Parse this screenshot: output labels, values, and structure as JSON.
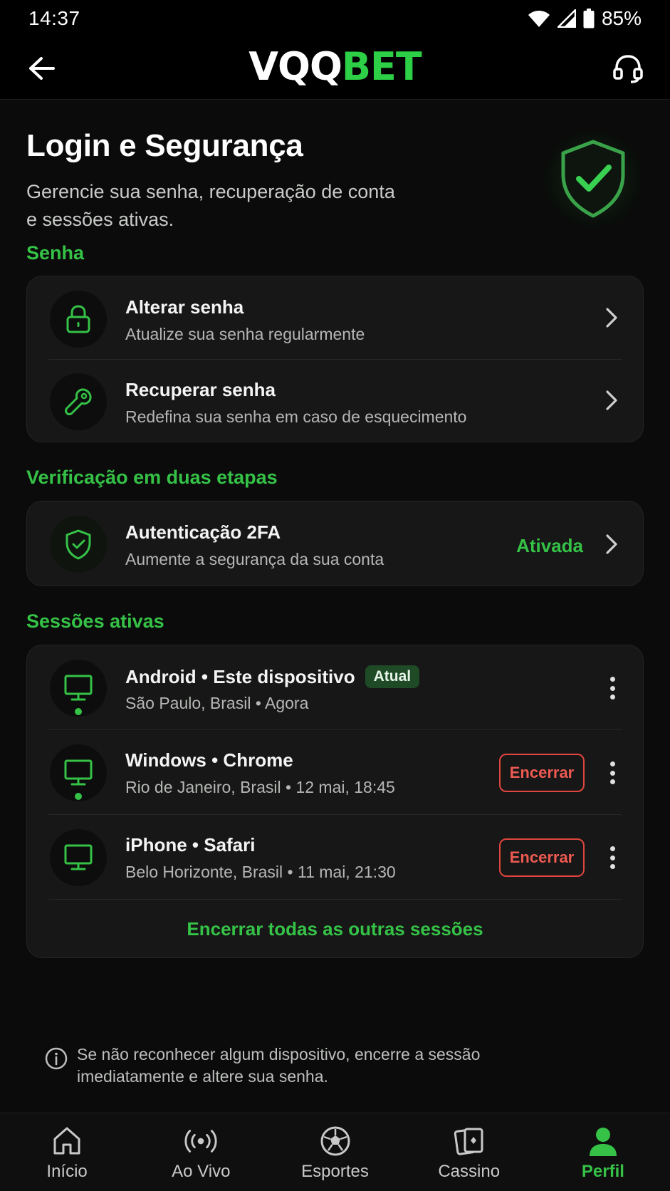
{
  "status_bar": {
    "time": "14:37",
    "battery": "85%"
  },
  "header": {
    "logo_white": "VQQ",
    "logo_green": "BET"
  },
  "hero": {
    "title": "Login e Segurança",
    "subtitle_line1": "Gerencie sua senha, recuperação de conta",
    "subtitle_line2": "e sessões ativas."
  },
  "password_section": {
    "label": "Senha",
    "items": [
      {
        "title": "Alterar senha",
        "subtitle": "Atualize sua senha regularmente",
        "icon": "lock-icon"
      },
      {
        "title": "Recuperar senha",
        "subtitle": "Redefina sua senha em caso de esquecimento",
        "icon": "key-icon"
      }
    ]
  },
  "twofa_section": {
    "label": "Verificação em duas etapas",
    "title": "Autenticação 2FA",
    "subtitle": "Aumente a segurança da sua conta",
    "status": "Ativada",
    "icon": "shield-check-icon"
  },
  "sessions_section": {
    "label": "Sessões ativas",
    "sessions": [
      {
        "title": "Android • Este dispositivo",
        "badge": "Atual",
        "subtitle": "São Paulo, Brasil • Agora",
        "online": true
      },
      {
        "title": "Windows • Chrome",
        "subtitle": "Rio de Janeiro, Brasil • 12 mai, 18:45",
        "action": "Encerrar",
        "online": true
      },
      {
        "title": "iPhone • Safari",
        "subtitle": "Belo Horizonte, Brasil • 11 mai, 21:30",
        "action": "Encerrar",
        "online": false
      }
    ],
    "end_all_label": "Encerrar todas as outras sessões"
  },
  "info_note": {
    "line1": "Se não reconhecer algum dispositivo, encerre a sessão",
    "line2": "imediatamente e altere sua senha."
  },
  "bottom_nav": {
    "items": [
      {
        "label": "Início",
        "icon": "home-icon",
        "active": false
      },
      {
        "label": "Ao Vivo",
        "icon": "live-broadcast-icon",
        "active": false
      },
      {
        "label": "Esportes",
        "icon": "soccer-ball-icon",
        "active": false
      },
      {
        "label": "Cassino",
        "icon": "cards-icon",
        "active": false
      },
      {
        "label": "Perfil",
        "icon": "user-icon",
        "active": true
      }
    ]
  },
  "colors": {
    "accent_green": "#35c247",
    "danger_red": "#e0463f",
    "background": "#0a0b0a",
    "card": "#161716"
  }
}
